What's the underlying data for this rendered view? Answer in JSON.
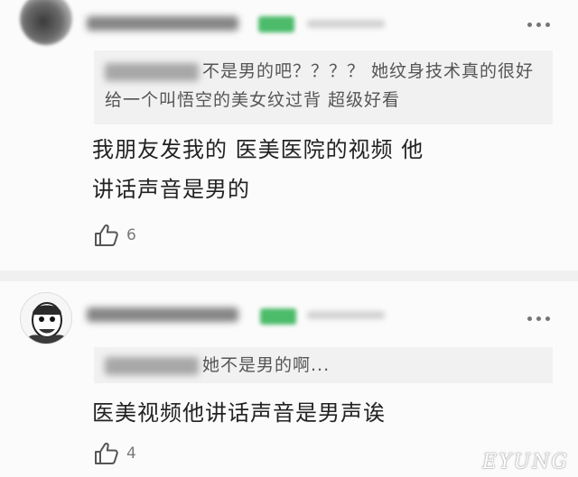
{
  "comments": [
    {
      "quote": {
        "text": "不是男的吧？？？？ 她纹身技术真的很好 给一个叫悟空的美女纹过背 超级好看"
      },
      "body": "我朋友发我的 医美医院的视频 他\n讲话声音是男的",
      "likes": "6"
    },
    {
      "quote": {
        "text": "她不是男的啊..."
      },
      "body": "医美视频他讲话声音是男声诶",
      "likes": "4"
    }
  ],
  "icons": {
    "like": "thumbs-up-icon",
    "more": "more-dots-icon"
  },
  "watermark": "EYUNG",
  "colors": {
    "badge": "#4cbb6a",
    "quote_bg": "#f1f1f1",
    "text": "#222222",
    "meta": "#7a7a7a"
  }
}
